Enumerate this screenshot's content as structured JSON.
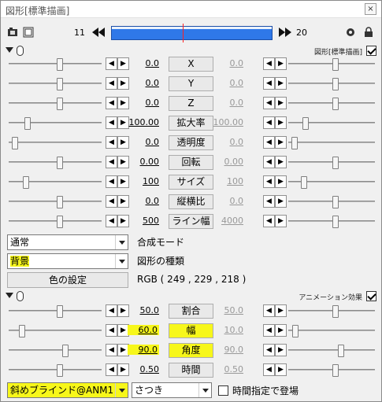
{
  "window": {
    "title": "図形[標準描画]",
    "close_label": "×"
  },
  "timeline": {
    "start": "11",
    "end": "20",
    "cursor_fraction": 0.44
  },
  "section_main": {
    "label": "図形[標準描画]",
    "checked": true
  },
  "params": [
    {
      "label": "X",
      "left": "0.0",
      "right": "0.0",
      "thumb_left": 0.55,
      "thumb_right": 0.55,
      "hl": false
    },
    {
      "label": "Y",
      "left": "0.0",
      "right": "0.0",
      "thumb_left": 0.55,
      "thumb_right": 0.55,
      "hl": false
    },
    {
      "label": "Z",
      "left": "0.0",
      "right": "0.0",
      "thumb_left": 0.55,
      "thumb_right": 0.55,
      "hl": false
    },
    {
      "label": "拡大率",
      "left": "100.00",
      "right": "100.00",
      "thumb_left": 0.18,
      "thumb_right": 0.18,
      "hl": false
    },
    {
      "label": "透明度",
      "left": "0.0",
      "right": "0.0",
      "thumb_left": 0.04,
      "thumb_right": 0.04,
      "hl": false
    },
    {
      "label": "回転",
      "left": "0.00",
      "right": "0.00",
      "thumb_left": 0.55,
      "thumb_right": 0.55,
      "hl": false
    },
    {
      "label": "サイズ",
      "left": "100",
      "right": "100",
      "thumb_left": 0.16,
      "thumb_right": 0.16,
      "hl": false
    },
    {
      "label": "縦横比",
      "left": "0.0",
      "right": "0.0",
      "thumb_left": 0.55,
      "thumb_right": 0.55,
      "hl": false
    },
    {
      "label": "ライン幅",
      "left": "500",
      "right": "4000",
      "thumb_left": 0.55,
      "thumb_right": 0.55,
      "hl": false
    }
  ],
  "blend": {
    "value": "通常",
    "label": "合成モード"
  },
  "shape": {
    "value": "背景",
    "label": "図形の種類"
  },
  "color": {
    "button": "色の設定",
    "rgb": "RGB ( 249 , 229 , 218 )"
  },
  "section_anim": {
    "label": "アニメーション効果",
    "checked": true
  },
  "anim_params": [
    {
      "label": "割合",
      "left": "50.0",
      "right": "50.0",
      "thumb_left": 0.55,
      "thumb_right": 0.55,
      "hl": false
    },
    {
      "label": "幅",
      "left": "60.0",
      "right": "10.0",
      "thumb_left": 0.12,
      "thumb_right": 0.05,
      "hl": true
    },
    {
      "label": "角度",
      "left": "90.0",
      "right": "90.0",
      "thumb_left": 0.62,
      "thumb_right": 0.62,
      "hl": true
    },
    {
      "label": "時間",
      "left": "0.50",
      "right": "0.50",
      "thumb_left": 0.55,
      "thumb_right": 0.55,
      "hl": false
    }
  ],
  "effect": {
    "value": "斜めブラインド@ANM1",
    "sub": "さつき",
    "timing_label": "時間指定で登場",
    "timing_checked": false
  },
  "colors": {
    "highlight": "#f7f71a",
    "timeline": "#2f78e8"
  }
}
